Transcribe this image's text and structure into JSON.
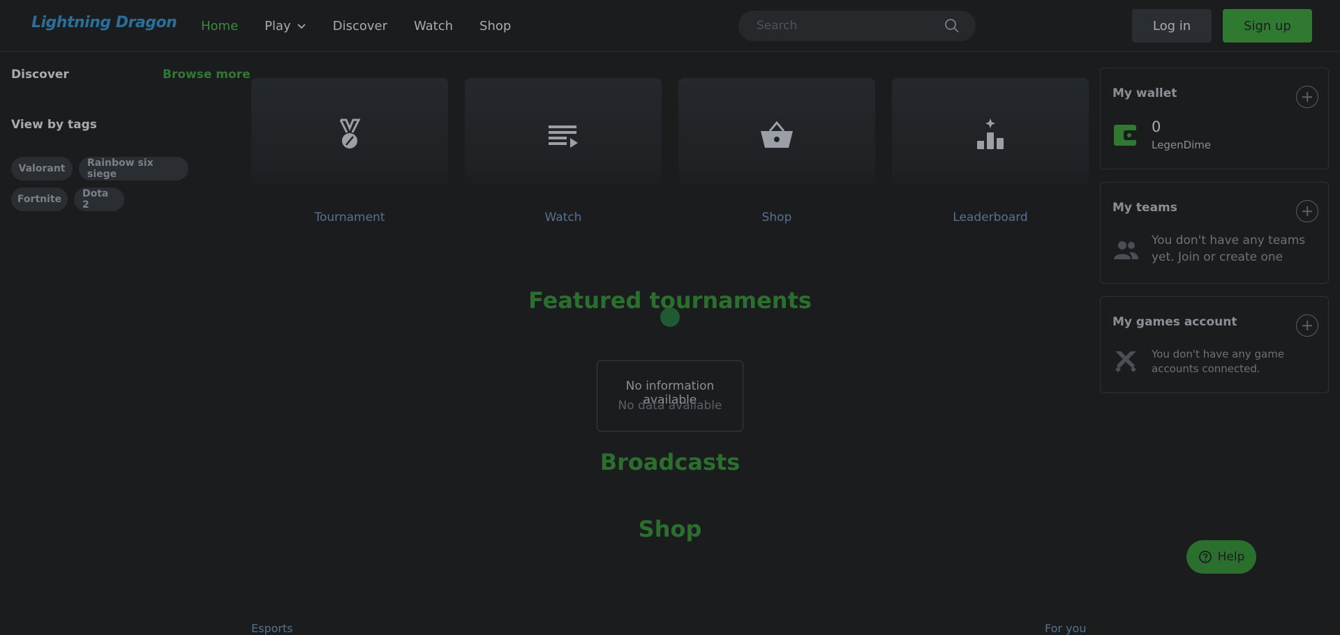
{
  "header": {
    "logo": "Lightning Dragon",
    "nav": [
      {
        "label": "Home"
      },
      {
        "label": "Play"
      },
      {
        "label": "Discover"
      },
      {
        "label": "Watch"
      },
      {
        "label": "Shop"
      }
    ],
    "search_placeholder": "Search",
    "login_label": "Log in",
    "signup_label": "Sign up"
  },
  "sidebar": {
    "discover_label": "Discover",
    "browse_more_label": "Browse more",
    "tags_title": "View by tags",
    "tags": [
      "Valorant",
      "Rainbow six siege",
      "Fortnite",
      "Dota 2"
    ]
  },
  "tiles": [
    {
      "label": "Tournament",
      "icon": "medal-icon"
    },
    {
      "label": "Watch",
      "icon": "playlist-icon"
    },
    {
      "label": "Shop",
      "icon": "basket-icon"
    },
    {
      "label": "Leaderboard",
      "icon": "podium-icon"
    }
  ],
  "sections": {
    "featured_title": "Featured tournaments",
    "nodata_line1": "No information available",
    "nodata_line2": "No data available",
    "broadcasts_title": "Broadcasts",
    "shop_title": "Shop"
  },
  "panels": {
    "wallet": {
      "title": "My wallet",
      "amount": "0",
      "unit": "LegenDime"
    },
    "teams": {
      "title": "My teams",
      "message": "You don't have any teams yet. Join or create one"
    },
    "games": {
      "title": "My games account",
      "message": "You don't have any game accounts connected."
    }
  },
  "help_label": "Help",
  "footer": {
    "left": "Esports",
    "right": "For you"
  },
  "colors": {
    "accent_green": "#2f7a30",
    "logo_blue": "#2a6f9a",
    "background": "#1b1c1e"
  }
}
